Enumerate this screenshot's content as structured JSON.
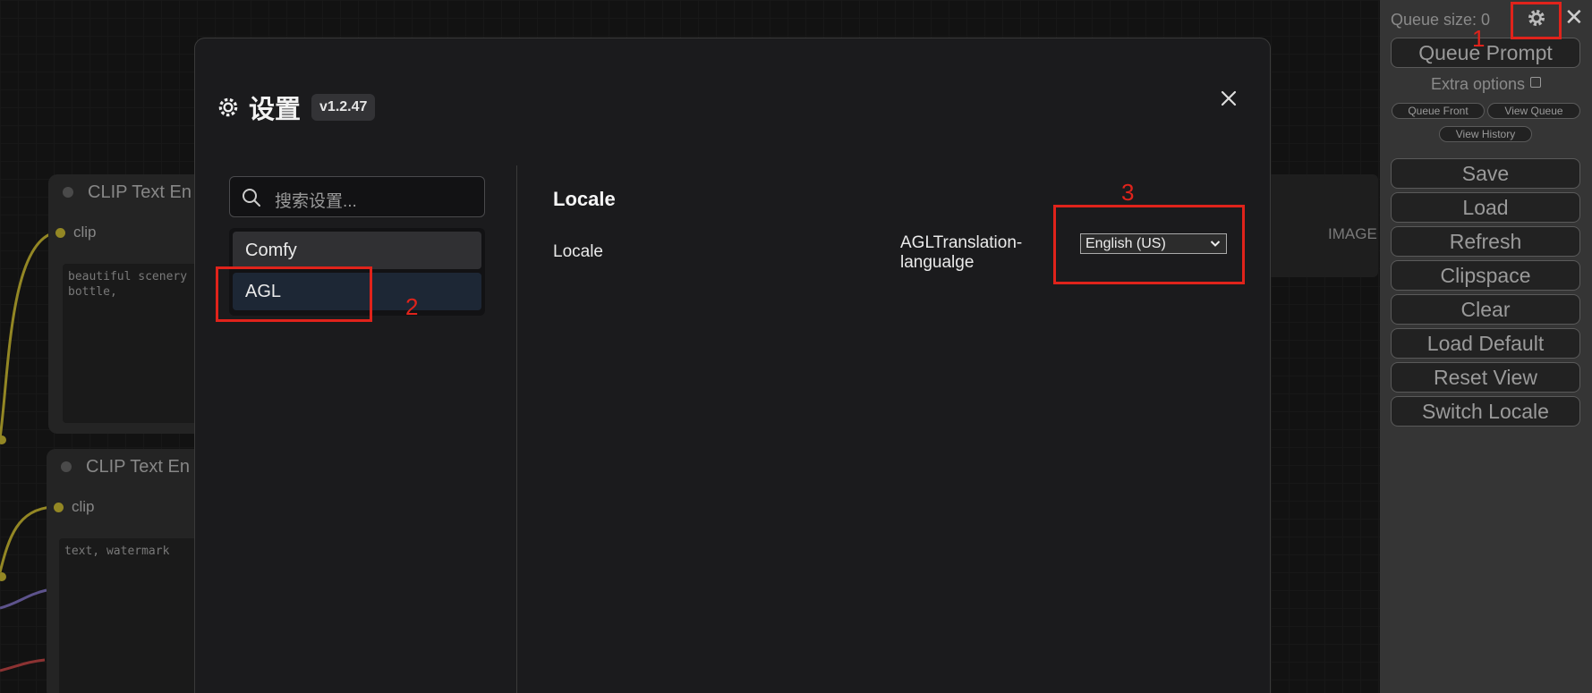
{
  "canvas": {
    "node1": {
      "title": "CLIP Text En",
      "slot": "clip",
      "text": "beautiful scenery\nbottle,"
    },
    "node2": {
      "title": "CLIP Text En",
      "slot": "clip",
      "text": "text, watermark"
    },
    "image_label": "IMAGE"
  },
  "menu": {
    "queue_size": "Queue size: 0",
    "queue_prompt": "Queue Prompt",
    "extra_options": "Extra options",
    "queue_front": "Queue Front",
    "view_queue": "View Queue",
    "view_history": "View History",
    "save": "Save",
    "load": "Load",
    "refresh": "Refresh",
    "clipspace": "Clipspace",
    "clear": "Clear",
    "load_default": "Load Default",
    "reset_view": "Reset View",
    "switch_locale": "Switch Locale",
    "close": "✕"
  },
  "settings": {
    "title": "设置",
    "version": "v1.2.47",
    "search_placeholder": "搜索设置...",
    "categories": [
      "Comfy",
      "AGL"
    ],
    "section_title": "Locale",
    "row_label": "Locale",
    "setting_name": "AGLTranslation-langualge",
    "setting_value": "English (US)"
  },
  "annotations": {
    "a1": "1",
    "a2": "2",
    "a3": "3"
  },
  "colors": {
    "annotation": "#e0231b",
    "selected_category": "#1d2735"
  }
}
